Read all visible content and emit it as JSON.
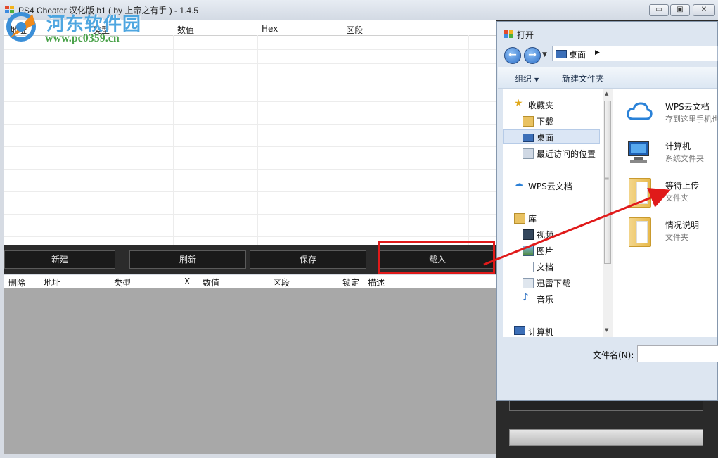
{
  "window": {
    "title": "PS4 Cheater 汉化版 b1 ( by 上帝之有手 ) - 1.4.5",
    "minimize": "▭",
    "maximize": "▣",
    "close": "✕"
  },
  "watermark": {
    "title": "河东软件园",
    "url": "www.pc0359.cn"
  },
  "grid": {
    "columns": [
      "地址",
      "类型",
      "数值",
      "Hex",
      "区段"
    ]
  },
  "buttons": {
    "new": "新建",
    "refresh": "刷新",
    "save": "保存",
    "load": "载入"
  },
  "lower_list": {
    "columns": [
      "删除",
      "地址",
      "类型",
      "X",
      "数值",
      "区段",
      "锁定",
      "描述"
    ]
  },
  "dialog": {
    "title": "打开",
    "address": "桌面",
    "toolbar": {
      "organize": "组织",
      "new_folder": "新建文件夹"
    },
    "nav": {
      "favorites": "收藏夹",
      "downloads": "下载",
      "desktop": "桌面",
      "recent": "最近访问的位置",
      "wps": "WPS云文档",
      "libraries": "库",
      "videos": "视频",
      "pictures": "图片",
      "documents": "文档",
      "xunlei": "迅雷下载",
      "music": "音乐",
      "computer": "计算机"
    },
    "files": [
      {
        "name": "WPS云文档",
        "desc": "存到这里手机也"
      },
      {
        "name": "计算机",
        "desc": "系统文件夹"
      },
      {
        "name": "等待上传",
        "desc": "文件夹"
      },
      {
        "name": "情况说明",
        "desc": "文件夹"
      }
    ],
    "filename_label": "文件名(N):",
    "filename_value": ""
  },
  "colors": {
    "highlight": "#e01a1a",
    "dark_panel": "#2b2b2b",
    "lower_list_bg": "#a8a8a8"
  }
}
